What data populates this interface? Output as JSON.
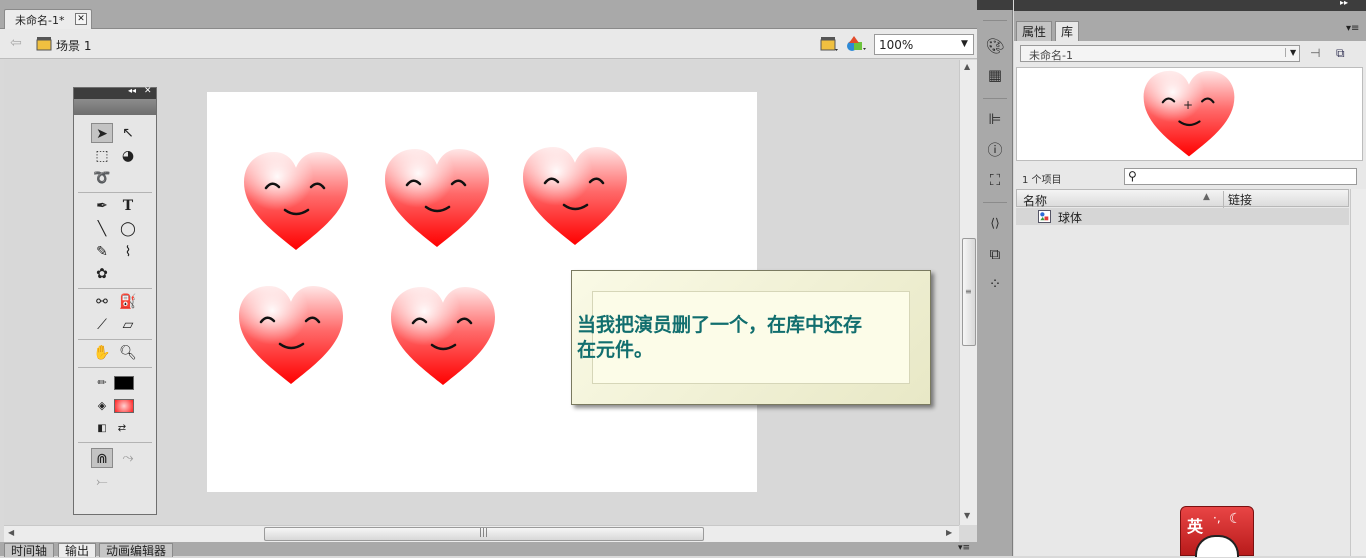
{
  "document": {
    "tab_title": "未命名-1*",
    "close_glyph": "✕"
  },
  "editbar": {
    "scene_label": "场景 1",
    "zoom": "100%"
  },
  "bottom_tabs": [
    "时间轴",
    "输出",
    "动画编辑器"
  ],
  "callout": {
    "text": "当我把演员删了一个，在库中还存在元件。"
  },
  "library": {
    "tabs": [
      "属性",
      "库"
    ],
    "document_name": "未命名-1",
    "item_count": "1 个项目",
    "columns": {
      "name": "名称",
      "linkage": "链接"
    },
    "items": [
      {
        "name": "球体",
        "icon": "movie-clip-symbol-icon"
      }
    ]
  },
  "tools": [
    "selection-tool-icon",
    "subselection-tool-icon",
    "free-transform-tool-icon",
    "3d-rotation-tool-icon",
    "lasso-tool-icon",
    "pen-tool-icon",
    "text-tool-icon",
    "line-tool-icon",
    "oval-tool-icon",
    "pencil-tool-icon",
    "brush-tool-icon",
    "deco-tool-icon",
    "bone-tool-icon",
    "paint-bucket-tool-icon",
    "eyedropper-tool-icon",
    "eraser-tool-icon",
    "hand-tool-icon",
    "zoom-tool-icon"
  ],
  "colors": {
    "stroke": "#000000",
    "fill": "#ff2020",
    "heart_top": "#ffe6e6",
    "heart_bottom": "#ff0000",
    "callout_text": "#116e6e"
  },
  "ime": {
    "label": "英"
  }
}
